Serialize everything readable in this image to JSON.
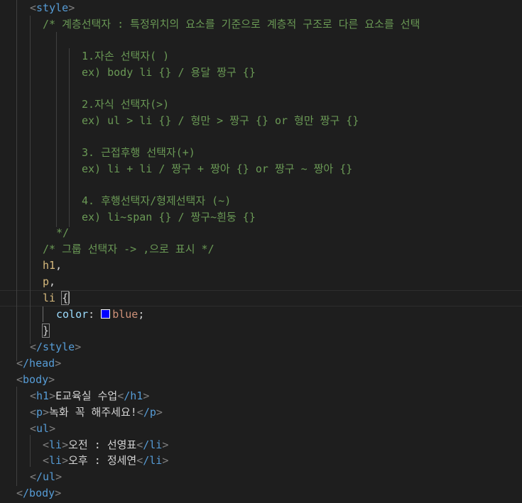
{
  "code": {
    "style_open_tag": "style",
    "comment_1": "/* 계층선택자 : 특정위치의 요소를 기준으로 계층적 구조로 다른 요소를 선택",
    "comment_2": "1.자손 선택자( )",
    "comment_3": "ex) body li {} / 용달 짱구 {}",
    "comment_4": "2.자식 선택자(>)",
    "comment_5": "ex) ul > li {} / 형만 > 짱구 {} or 형만 짱구 {}",
    "comment_6": "3. 근접후행 선택자(+)",
    "comment_7": "ex) li + li / 짱구 + 짱아 {} or 짱구 ~ 짱아 {}",
    "comment_8": "4. 후행선택자/형제선택자 (~)",
    "comment_9": "ex) li~span {} / 짱구~흰둥 {}",
    "comment_10": "*/",
    "comment_11": "/* 그룹 선택자 -> ,으로 표시 */",
    "sel_h1": "h1",
    "sel_p": "p",
    "sel_li": "li",
    "comma": ",",
    "brace_open": "{",
    "brace_close": "}",
    "prop_color": "color",
    "colon": ":",
    "value_blue": "blue",
    "semicolon": ";",
    "style_close_tag": "/style",
    "head_close_tag": "/head",
    "body_open_tag": "body",
    "h1_tag": "h1",
    "h1_text": "E교육실 수업",
    "h1_close_tag": "/h1",
    "p_tag": "p",
    "p_text": "녹화 꼭 해주세요!",
    "p_close_tag": "/p",
    "ul_tag": "ul",
    "li_tag": "li",
    "li1_text": "오전 : 선영표",
    "li_close_tag": "/li",
    "li2_text": "오후 : 정세연",
    "ul_close_tag": "/ul",
    "body_close_tag": "/body"
  },
  "colors": {
    "background": "#1e1e1e",
    "tag": "#569cd6",
    "bracket": "#808080",
    "comment": "#6a9955",
    "selector": "#d7ba7d",
    "property": "#9cdcfe",
    "value": "#ce9178",
    "swatch_blue": "#0000ff"
  }
}
